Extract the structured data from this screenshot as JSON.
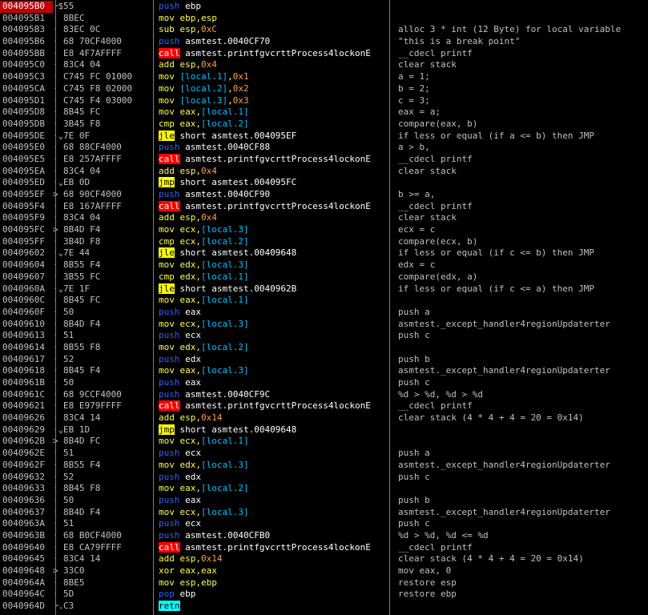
{
  "rows": [
    {
      "addr": "004095B0",
      "gut": "┌$",
      "hex": "55",
      "mn": "push",
      "type": "stk",
      "ops": [
        [
          "ebp",
          "r"
        ]
      ],
      "cmt": ""
    },
    {
      "addr": "004095B1",
      "gut": "·",
      "hex": "8BEC",
      "mn": "mov",
      "type": "std",
      "ops": [
        [
          "ebp,esp",
          "r"
        ]
      ],
      "cmt": ""
    },
    {
      "addr": "004095B3",
      "gut": "·",
      "hex": "83EC 0C",
      "mn": "sub",
      "type": "std",
      "ops": [
        [
          "esp,",
          "r"
        ],
        [
          "0xC",
          "i"
        ]
      ],
      "cmt": "alloc 3 * int (12 Byte) for local variable"
    },
    {
      "addr": "004095B6",
      "gut": "·",
      "hex": "68 70CF4000",
      "mn": "push",
      "type": "stk",
      "ops": [
        [
          "asmtest.0040CF70",
          "r"
        ]
      ],
      "cmt": "\"this is a break point\""
    },
    {
      "addr": "004095BB",
      "gut": "·",
      "hex": "E8 4F7AFFFF",
      "mn": "call",
      "type": "call",
      "ops": [
        [
          "asmtest.printfgvcrttProcess4lockonE",
          "r"
        ]
      ],
      "cmt": "__cdecl printf"
    },
    {
      "addr": "004095C0",
      "gut": "·",
      "hex": "83C4 04",
      "mn": "add",
      "type": "std",
      "ops": [
        [
          "esp,",
          "r"
        ],
        [
          "0x4",
          "i"
        ]
      ],
      "cmt": "clear stack"
    },
    {
      "addr": "004095C3",
      "gut": "·",
      "hex": "C745 FC 01000",
      "mn": "mov",
      "type": "std",
      "ops": [
        [
          "[local.1]",
          "m"
        ],
        [
          ",",
          "r"
        ],
        [
          "0x1",
          "i"
        ]
      ],
      "cmt": "a = 1;"
    },
    {
      "addr": "004095CA",
      "gut": "·",
      "hex": "C745 F8 02000",
      "mn": "mov",
      "type": "std",
      "ops": [
        [
          "[local.2]",
          "m"
        ],
        [
          ",",
          "r"
        ],
        [
          "0x2",
          "i"
        ]
      ],
      "cmt": "b = 2;"
    },
    {
      "addr": "004095D1",
      "gut": "·",
      "hex": "C745 F4 03000",
      "mn": "mov",
      "type": "std",
      "ops": [
        [
          "[local.3]",
          "m"
        ],
        [
          ",",
          "r"
        ],
        [
          "0x3",
          "i"
        ]
      ],
      "cmt": "c = 3;"
    },
    {
      "addr": "004095D8",
      "gut": "·",
      "hex": "8B45 FC",
      "mn": "mov",
      "type": "std",
      "ops": [
        [
          "eax,",
          "r"
        ],
        [
          "[local.1]",
          "m"
        ]
      ],
      "cmt": "eax = a;"
    },
    {
      "addr": "004095DB",
      "gut": "·",
      "hex": "3B45 F8",
      "mn": "cmp",
      "type": "std",
      "ops": [
        [
          "eax,",
          "r"
        ],
        [
          "[local.2]",
          "m"
        ]
      ],
      "cmt": "compare(eax, b)"
    },
    {
      "addr": "004095DE",
      "gut": "·⌄",
      "hex": "7E 0F",
      "mn": "jle",
      "type": "jcc",
      "ops": [
        [
          "short asmtest.004095EF",
          "r"
        ]
      ],
      "cmt": "if less or equal (if a <= b) then JMP"
    },
    {
      "addr": "004095E0",
      "gut": "·",
      "hex": "68 88CF4000",
      "mn": "push",
      "type": "stk",
      "ops": [
        [
          "asmtest.0040CF88",
          "r"
        ]
      ],
      "cmt": "a > b,"
    },
    {
      "addr": "004095E5",
      "gut": "·",
      "hex": "E8 257AFFFF",
      "mn": "call",
      "type": "call",
      "ops": [
        [
          "asmtest.printfgvcrttProcess4lockonE",
          "r"
        ]
      ],
      "cmt": "__cdecl printf"
    },
    {
      "addr": "004095EA",
      "gut": "·",
      "hex": "83C4 04",
      "mn": "add",
      "type": "std",
      "ops": [
        [
          "esp,",
          "r"
        ],
        [
          "0x4",
          "i"
        ]
      ],
      "cmt": "clear stack"
    },
    {
      "addr": "004095ED",
      "gut": "·⌄",
      "hex": "EB 0D",
      "mn": "jmp",
      "type": "jmp",
      "ops": [
        [
          "short asmtest.004095FC",
          "r"
        ]
      ],
      "cmt": ""
    },
    {
      "addr": "004095EF",
      "gut": ">",
      "hex": "68 90CF4000",
      "mn": "push",
      "type": "stk",
      "ops": [
        [
          "asmtest.0040CF90",
          "r"
        ]
      ],
      "cmt": "b >= a,"
    },
    {
      "addr": "004095F4",
      "gut": "·",
      "hex": "E8 167AFFFF",
      "mn": "call",
      "type": "call",
      "ops": [
        [
          "asmtest.printfgvcrttProcess4lockonE",
          "r"
        ]
      ],
      "cmt": "__cdecl printf"
    },
    {
      "addr": "004095F9",
      "gut": "·",
      "hex": "83C4 04",
      "mn": "add",
      "type": "std",
      "ops": [
        [
          "esp,",
          "r"
        ],
        [
          "0x4",
          "i"
        ]
      ],
      "cmt": "clear stack"
    },
    {
      "addr": "004095FC",
      "gut": ">",
      "hex": "8B4D F4",
      "mn": "mov",
      "type": "std",
      "ops": [
        [
          "ecx,",
          "r"
        ],
        [
          "[local.3]",
          "m"
        ]
      ],
      "cmt": "ecx = c"
    },
    {
      "addr": "004095FF",
      "gut": "·",
      "hex": "3B4D F8",
      "mn": "cmp",
      "type": "std",
      "ops": [
        [
          "ecx,",
          "r"
        ],
        [
          "[local.2]",
          "m"
        ]
      ],
      "cmt": "compare(ecx, b)"
    },
    {
      "addr": "00409602",
      "gut": "·⌄",
      "hex": "7E 44",
      "mn": "jle",
      "type": "jcc",
      "ops": [
        [
          "short asmtest.00409648",
          "r"
        ]
      ],
      "cmt": "if less or equal (if c <= b) then JMP"
    },
    {
      "addr": "00409604",
      "gut": "·",
      "hex": "8B55 F4",
      "mn": "mov",
      "type": "std",
      "ops": [
        [
          "edx,",
          "r"
        ],
        [
          "[local.3]",
          "m"
        ]
      ],
      "cmt": "edx = c"
    },
    {
      "addr": "00409607",
      "gut": "·",
      "hex": "3B55 FC",
      "mn": "cmp",
      "type": "std",
      "ops": [
        [
          "edx,",
          "r"
        ],
        [
          "[local.1]",
          "m"
        ]
      ],
      "cmt": "compare(edx, a)"
    },
    {
      "addr": "0040960A",
      "gut": "·⌄",
      "hex": "7E 1F",
      "mn": "jle",
      "type": "jcc",
      "ops": [
        [
          "short asmtest.0040962B",
          "r"
        ]
      ],
      "cmt": "if less or equal (if c <= a) then JMP"
    },
    {
      "addr": "0040960C",
      "gut": "·",
      "hex": "8B45 FC",
      "mn": "mov",
      "type": "std",
      "ops": [
        [
          "eax,",
          "r"
        ],
        [
          "[local.1]",
          "m"
        ]
      ],
      "cmt": ""
    },
    {
      "addr": "0040960F",
      "gut": "·",
      "hex": "50",
      "mn": "push",
      "type": "stk",
      "ops": [
        [
          "eax",
          "r"
        ]
      ],
      "cmt": "push a"
    },
    {
      "addr": "00409610",
      "gut": "·",
      "hex": "8B4D F4",
      "mn": "mov",
      "type": "std",
      "ops": [
        [
          "ecx,",
          "r"
        ],
        [
          "[local.3]",
          "m"
        ]
      ],
      "cmt": "asmtest._except_handler4regionUpdaterter"
    },
    {
      "addr": "00409613",
      "gut": "·",
      "hex": "51",
      "mn": "push",
      "type": "stk",
      "ops": [
        [
          "ecx",
          "r"
        ]
      ],
      "cmt": "push c"
    },
    {
      "addr": "00409614",
      "gut": "·",
      "hex": "8B55 F8",
      "mn": "mov",
      "type": "std",
      "ops": [
        [
          "edx,",
          "r"
        ],
        [
          "[local.2]",
          "m"
        ]
      ],
      "cmt": ""
    },
    {
      "addr": "00409617",
      "gut": "·",
      "hex": "52",
      "mn": "push",
      "type": "stk",
      "ops": [
        [
          "edx",
          "r"
        ]
      ],
      "cmt": "push b"
    },
    {
      "addr": "00409618",
      "gut": "·",
      "hex": "8B45 F4",
      "mn": "mov",
      "type": "std",
      "ops": [
        [
          "eax,",
          "r"
        ],
        [
          "[local.3]",
          "m"
        ]
      ],
      "cmt": "asmtest._except_handler4regionUpdaterter"
    },
    {
      "addr": "0040961B",
      "gut": "·",
      "hex": "50",
      "mn": "push",
      "type": "stk",
      "ops": [
        [
          "eax",
          "r"
        ]
      ],
      "cmt": "push c"
    },
    {
      "addr": "0040961C",
      "gut": "·",
      "hex": "68 9CCF4000",
      "mn": "push",
      "type": "stk",
      "ops": [
        [
          "asmtest.0040CF9C",
          "r"
        ]
      ],
      "cmt": "%d > %d, %d > %d"
    },
    {
      "addr": "00409621",
      "gut": "·",
      "hex": "E8 E979FFFF",
      "mn": "call",
      "type": "call",
      "ops": [
        [
          "asmtest.printfgvcrttProcess4lockonE",
          "r"
        ]
      ],
      "cmt": "__cdecl printf"
    },
    {
      "addr": "00409626",
      "gut": "·",
      "hex": "83C4 14",
      "mn": "add",
      "type": "std",
      "ops": [
        [
          "esp,",
          "r"
        ],
        [
          "0x14",
          "i"
        ]
      ],
      "cmt": "clear stack (4 * 4 + 4 = 20 = 0x14)"
    },
    {
      "addr": "00409629",
      "gut": "·⌄",
      "hex": "EB 1D",
      "mn": "jmp",
      "type": "jmp",
      "ops": [
        [
          "short asmtest.00409648",
          "r"
        ]
      ],
      "cmt": ""
    },
    {
      "addr": "0040962B",
      "gut": ">",
      "hex": "8B4D FC",
      "mn": "mov",
      "type": "std",
      "ops": [
        [
          "ecx,",
          "r"
        ],
        [
          "[local.1]",
          "m"
        ]
      ],
      "cmt": ""
    },
    {
      "addr": "0040962E",
      "gut": "·",
      "hex": "51",
      "mn": "push",
      "type": "stk",
      "ops": [
        [
          "ecx",
          "r"
        ]
      ],
      "cmt": "push a"
    },
    {
      "addr": "0040962F",
      "gut": "·",
      "hex": "8B55 F4",
      "mn": "mov",
      "type": "std",
      "ops": [
        [
          "edx,",
          "r"
        ],
        [
          "[local.3]",
          "m"
        ]
      ],
      "cmt": "asmtest._except_handler4regionUpdaterter"
    },
    {
      "addr": "00409632",
      "gut": "·",
      "hex": "52",
      "mn": "push",
      "type": "stk",
      "ops": [
        [
          "edx",
          "r"
        ]
      ],
      "cmt": "push c"
    },
    {
      "addr": "00409633",
      "gut": "·",
      "hex": "8B45 F8",
      "mn": "mov",
      "type": "std",
      "ops": [
        [
          "eax,",
          "r"
        ],
        [
          "[local.2]",
          "m"
        ]
      ],
      "cmt": ""
    },
    {
      "addr": "00409636",
      "gut": "·",
      "hex": "50",
      "mn": "push",
      "type": "stk",
      "ops": [
        [
          "eax",
          "r"
        ]
      ],
      "cmt": "push b"
    },
    {
      "addr": "00409637",
      "gut": "·",
      "hex": "8B4D F4",
      "mn": "mov",
      "type": "std",
      "ops": [
        [
          "ecx,",
          "r"
        ],
        [
          "[local.3]",
          "m"
        ]
      ],
      "cmt": "asmtest._except_handler4regionUpdaterter"
    },
    {
      "addr": "0040963A",
      "gut": "·",
      "hex": "51",
      "mn": "push",
      "type": "stk",
      "ops": [
        [
          "ecx",
          "r"
        ]
      ],
      "cmt": "push c"
    },
    {
      "addr": "0040963B",
      "gut": "·",
      "hex": "68 B0CF4000",
      "mn": "push",
      "type": "stk",
      "ops": [
        [
          "asmtest.0040CFB0",
          "r"
        ]
      ],
      "cmt": "%d > %d, %d <= %d"
    },
    {
      "addr": "00409640",
      "gut": "·",
      "hex": "E8 CA79FFFF",
      "mn": "call",
      "type": "call",
      "ops": [
        [
          "asmtest.printfgvcrttProcess4lockonE",
          "r"
        ]
      ],
      "cmt": "__cdecl printf"
    },
    {
      "addr": "00409645",
      "gut": "·",
      "hex": "83C4 14",
      "mn": "add",
      "type": "std",
      "ops": [
        [
          "esp,",
          "r"
        ],
        [
          "0x14",
          "i"
        ]
      ],
      "cmt": "clear stack (4 * 4 + 4 = 20 = 0x14)"
    },
    {
      "addr": "00409648",
      "gut": ">",
      "hex": "33C0",
      "mn": "xor",
      "type": "std",
      "ops": [
        [
          "eax,eax",
          "r"
        ]
      ],
      "cmt": "mov eax, 0"
    },
    {
      "addr": "0040964A",
      "gut": "·",
      "hex": "8BE5",
      "mn": "mov",
      "type": "std",
      "ops": [
        [
          "esp,ebp",
          "r"
        ]
      ],
      "cmt": "restore esp"
    },
    {
      "addr": "0040964C",
      "gut": "·",
      "hex": "5D",
      "mn": "pop",
      "type": "stk",
      "ops": [
        [
          "ebp",
          "r"
        ]
      ],
      "cmt": "restore ebp"
    },
    {
      "addr": "0040964D",
      "gut": "└.",
      "hex": "C3",
      "mn": "retn",
      "type": "ret",
      "ops": [],
      "cmt": ""
    }
  ],
  "selected_row": 0,
  "colors": {
    "background": "#000000",
    "selected_addr_bg": "#c00000",
    "call_bg": "#ff0000",
    "jump_bg": "#ffff00",
    "ret_bg": "#00ffff",
    "stack_op": "#3060ff",
    "mnemonic": "#ffff40"
  }
}
